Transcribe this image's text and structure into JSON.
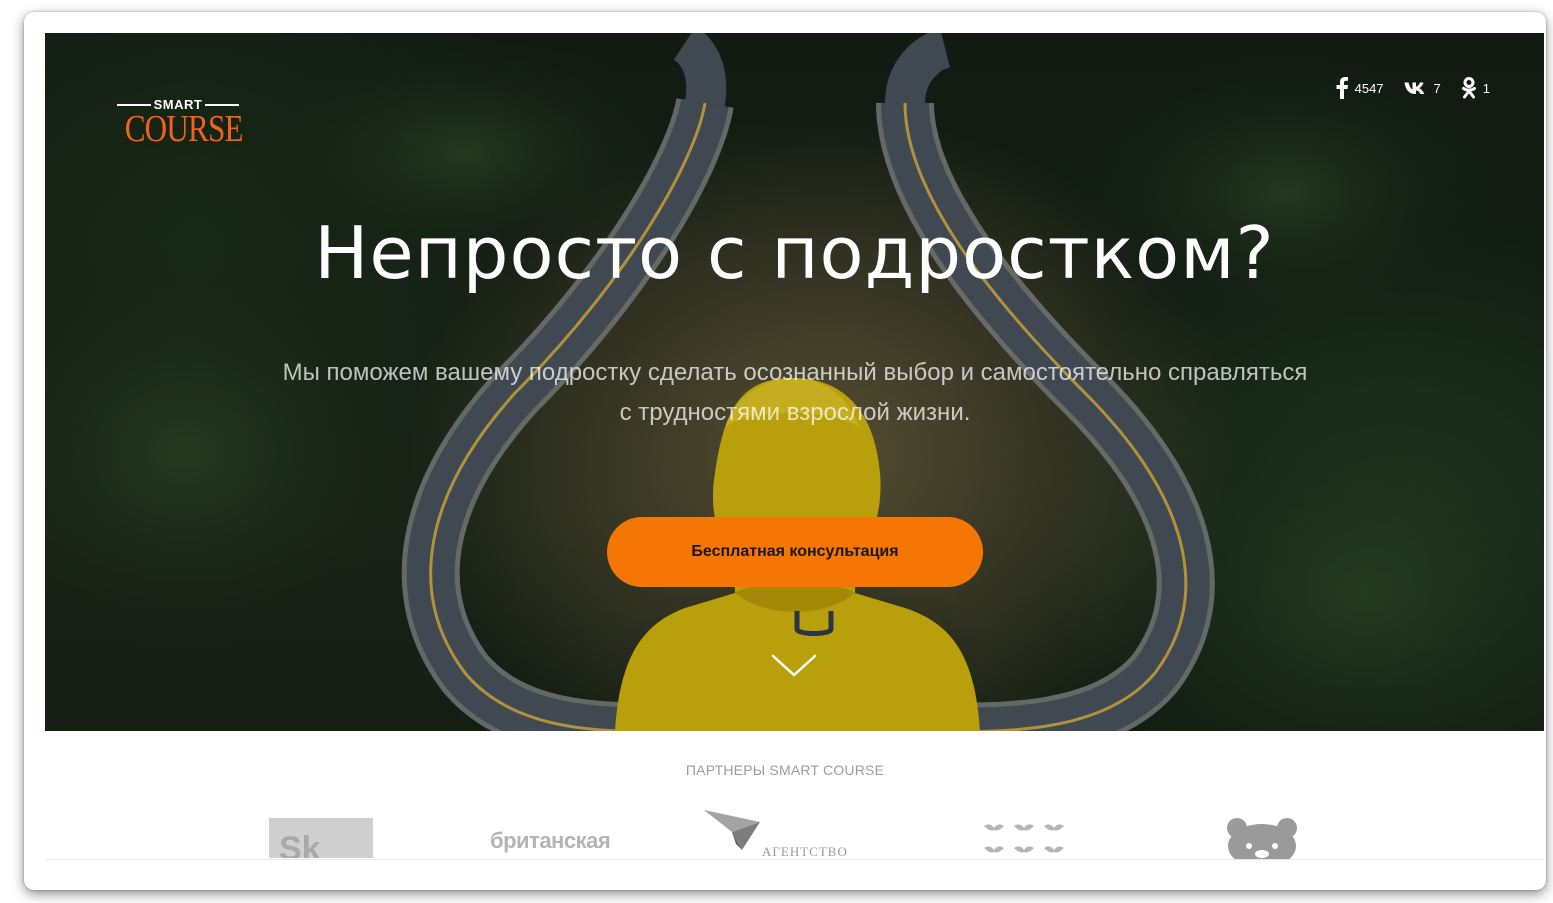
{
  "brand": {
    "logo_top": "SMART",
    "logo_bottom": "COURSE",
    "accent_color": "#f2611d"
  },
  "social": [
    {
      "name": "facebook",
      "icon": "facebook-icon",
      "glyph": "f",
      "count": "4547"
    },
    {
      "name": "vk",
      "icon": "vk-icon",
      "glyph": "vk",
      "count": "7"
    },
    {
      "name": "odnoklassniki",
      "icon": "odnoklassniki-icon",
      "glyph": "ok",
      "count": "1"
    }
  ],
  "hero": {
    "headline": "Непросто с подростком?",
    "subtitle_line1": "Мы поможем вашему подростку сделать осознанный выбор и самостоятельно справляться",
    "subtitle_line2": "с трудностями взрослой жизни.",
    "cta_label": "Бесплатная консультация",
    "cta_color": "#f57605",
    "scroll_icon": "chevron-down-icon"
  },
  "partners": {
    "title": "ПАРТНЕРЫ SMART COURSE",
    "items": [
      {
        "name": "sk",
        "text": "Sk"
      },
      {
        "name": "british",
        "text": "британская"
      },
      {
        "name": "agency",
        "text": "АГЕНТСТВО"
      },
      {
        "name": "bird",
        "text": ""
      },
      {
        "name": "bear",
        "text": ""
      }
    ]
  }
}
